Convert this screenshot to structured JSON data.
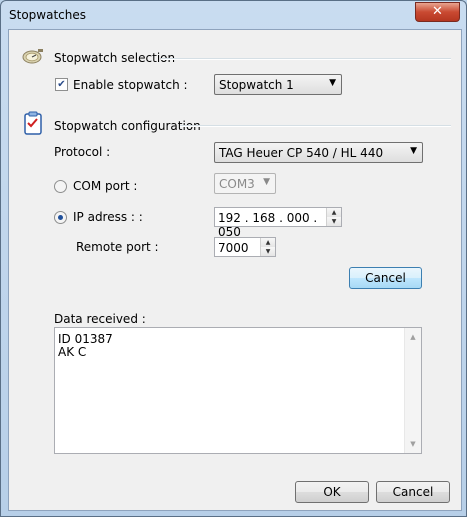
{
  "window": {
    "title": "Stopwatches",
    "close_symbol": "✕"
  },
  "selection": {
    "title": "Stopwatch selection",
    "enable_label": "Enable stopwatch :",
    "enable_checked": true,
    "stopwatch_value": "Stopwatch 1"
  },
  "configuration": {
    "title": "Stopwatch configuration",
    "protocol_label": "Protocol :",
    "protocol_value": "TAG Heuer CP 540 / HL 440",
    "com_label": "COM port :",
    "com_value": "COM3",
    "ip_label": "IP adress : :",
    "ip_value": "192 . 168 . 000 . 050",
    "remote_label": "Remote port :",
    "remote_value": "7000",
    "cancel_label": "Cancel",
    "selected_connection": "ip"
  },
  "data_received": {
    "label": "Data received :",
    "lines": [
      "ID 01387",
      "AK C"
    ]
  },
  "footer": {
    "ok_label": "OK",
    "cancel_label": "Cancel"
  },
  "icons": {
    "selection_icon": "stopwatch-icon",
    "configuration_icon": "checklist-icon"
  }
}
